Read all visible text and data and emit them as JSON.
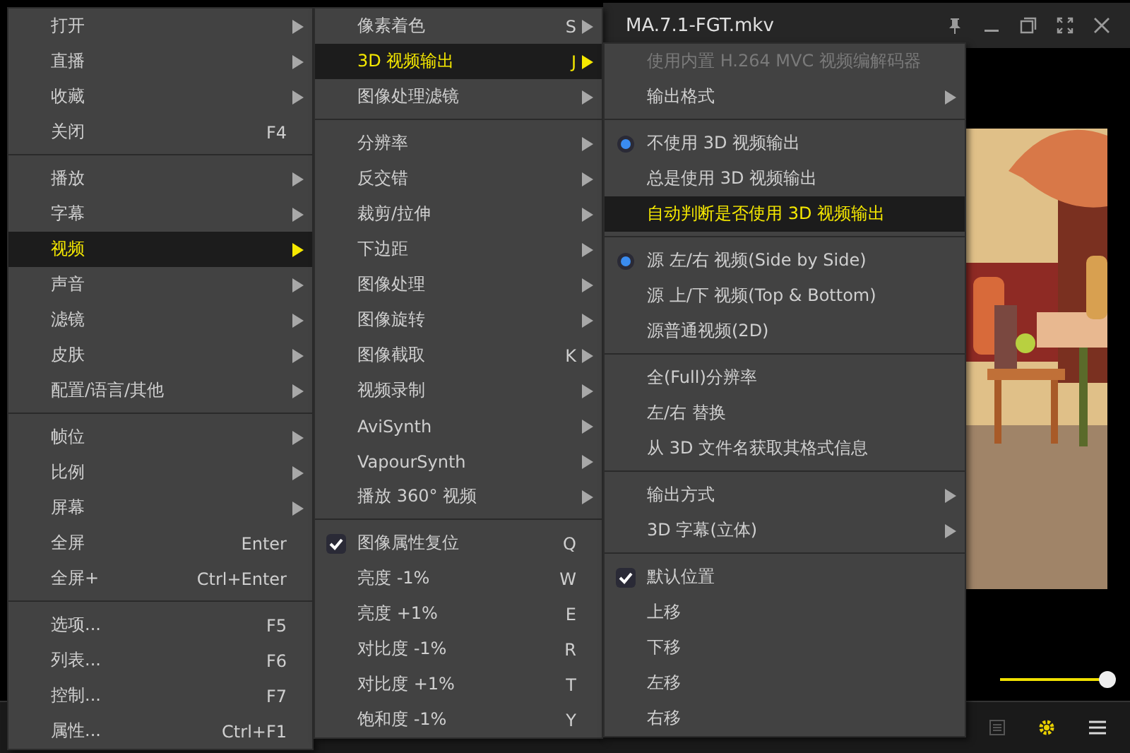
{
  "window": {
    "title": "MA.7.1-FGT.mkv"
  },
  "volume": {
    "level": 0.95
  },
  "menus": [
    {
      "items": [
        {
          "kind": "item",
          "label": "打开",
          "submenu": true,
          "selected": false
        },
        {
          "kind": "item",
          "label": "直播",
          "submenu": true,
          "selected": false
        },
        {
          "kind": "item",
          "label": "收藏",
          "submenu": true,
          "selected": false
        },
        {
          "kind": "item",
          "label": "关闭",
          "shortcut": "F4",
          "selected": false
        },
        {
          "kind": "separator"
        },
        {
          "kind": "item",
          "label": "播放",
          "submenu": true,
          "selected": false
        },
        {
          "kind": "item",
          "label": "字幕",
          "submenu": true,
          "selected": false
        },
        {
          "kind": "item",
          "label": "视频",
          "submenu": true,
          "selected": true
        },
        {
          "kind": "item",
          "label": "声音",
          "submenu": true,
          "selected": false
        },
        {
          "kind": "item",
          "label": "滤镜",
          "submenu": true,
          "selected": false
        },
        {
          "kind": "item",
          "label": "皮肤",
          "submenu": true,
          "selected": false
        },
        {
          "kind": "item",
          "label": "配置/语言/其他",
          "submenu": true,
          "selected": false
        },
        {
          "kind": "separator"
        },
        {
          "kind": "item",
          "label": "帧位",
          "submenu": true,
          "selected": false
        },
        {
          "kind": "item",
          "label": "比例",
          "submenu": true,
          "selected": false
        },
        {
          "kind": "item",
          "label": "屏幕",
          "submenu": true,
          "selected": false
        },
        {
          "kind": "item",
          "label": "全屏",
          "shortcut": "Enter",
          "selected": false
        },
        {
          "kind": "item",
          "label": "全屏+",
          "shortcut": "Ctrl+Enter",
          "selected": false
        },
        {
          "kind": "separator"
        },
        {
          "kind": "item",
          "label": "选项...",
          "shortcut": "F5",
          "selected": false
        },
        {
          "kind": "item",
          "label": "列表...",
          "shortcut": "F6",
          "selected": false
        },
        {
          "kind": "item",
          "label": "控制...",
          "shortcut": "F7",
          "selected": false
        },
        {
          "kind": "item",
          "label": "属性...",
          "shortcut": "Ctrl+F1",
          "selected": false
        }
      ]
    },
    {
      "items": [
        {
          "kind": "item",
          "label": "像素着色",
          "shortcut": "S",
          "submenu": true,
          "selected": false
        },
        {
          "kind": "item",
          "label": "3D 视频输出",
          "shortcut": "J",
          "submenu": true,
          "selected": true
        },
        {
          "kind": "item",
          "label": "图像处理滤镜",
          "submenu": true,
          "selected": false
        },
        {
          "kind": "separator"
        },
        {
          "kind": "item",
          "label": "分辨率",
          "submenu": true,
          "selected": false
        },
        {
          "kind": "item",
          "label": "反交错",
          "submenu": true,
          "selected": false
        },
        {
          "kind": "item",
          "label": "裁剪/拉伸",
          "submenu": true,
          "selected": false
        },
        {
          "kind": "item",
          "label": "下边距",
          "submenu": true,
          "selected": false
        },
        {
          "kind": "item",
          "label": "图像处理",
          "submenu": true,
          "selected": false
        },
        {
          "kind": "item",
          "label": "图像旋转",
          "submenu": true,
          "selected": false
        },
        {
          "kind": "item",
          "label": "图像截取",
          "shortcut": "K",
          "submenu": true,
          "selected": false
        },
        {
          "kind": "item",
          "label": "视频录制",
          "submenu": true,
          "selected": false
        },
        {
          "kind": "item",
          "label": "AviSynth",
          "submenu": true,
          "selected": false
        },
        {
          "kind": "item",
          "label": "VapourSynth",
          "submenu": true,
          "selected": false
        },
        {
          "kind": "item",
          "label": "播放 360° 视频",
          "submenu": true,
          "selected": false
        },
        {
          "kind": "separator"
        },
        {
          "kind": "check",
          "label": "图像属性复位",
          "shortcut": "Q",
          "checked": true,
          "selected": false
        },
        {
          "kind": "item",
          "label": "亮度 -1%",
          "shortcut": "W",
          "selected": false
        },
        {
          "kind": "item",
          "label": "亮度 +1%",
          "shortcut": "E",
          "selected": false
        },
        {
          "kind": "item",
          "label": "对比度 -1%",
          "shortcut": "R",
          "selected": false
        },
        {
          "kind": "item",
          "label": "对比度 +1%",
          "shortcut": "T",
          "selected": false
        },
        {
          "kind": "item",
          "label": "饱和度 -1%",
          "shortcut": "Y",
          "selected": false
        }
      ]
    },
    {
      "items": [
        {
          "kind": "item",
          "label": "使用内置 H.264 MVC 视频编解码器",
          "disabled": true,
          "selected": false
        },
        {
          "kind": "item",
          "label": "输出格式",
          "submenu": true,
          "selected": false
        },
        {
          "kind": "separator"
        },
        {
          "kind": "radio",
          "label": "不使用 3D 视频输出",
          "checked": true,
          "selected": false
        },
        {
          "kind": "radio",
          "label": "总是使用 3D 视频输出",
          "checked": false,
          "selected": false
        },
        {
          "kind": "radio",
          "label": "自动判断是否使用 3D 视频输出",
          "checked": false,
          "selected": true
        },
        {
          "kind": "separator"
        },
        {
          "kind": "radio",
          "label": "源 左/右 视频(Side by Side)",
          "checked": true,
          "selected": false
        },
        {
          "kind": "radio",
          "label": "源 上/下 视频(Top & Bottom)",
          "checked": false,
          "selected": false
        },
        {
          "kind": "radio",
          "label": "源普通视频(2D)",
          "checked": false,
          "selected": false
        },
        {
          "kind": "separator"
        },
        {
          "kind": "item",
          "label": "全(Full)分辨率",
          "selected": false
        },
        {
          "kind": "item",
          "label": "左/右 替换",
          "selected": false
        },
        {
          "kind": "item",
          "label": "从 3D 文件名获取其格式信息",
          "selected": false
        },
        {
          "kind": "separator"
        },
        {
          "kind": "item",
          "label": "输出方式",
          "submenu": true,
          "selected": false
        },
        {
          "kind": "item",
          "label": "3D 字幕(立体)",
          "submenu": true,
          "selected": false
        },
        {
          "kind": "separator"
        },
        {
          "kind": "check",
          "label": "默认位置",
          "checked": true,
          "selected": false
        },
        {
          "kind": "item",
          "label": "上移",
          "selected": false
        },
        {
          "kind": "item",
          "label": "下移",
          "selected": false
        },
        {
          "kind": "item",
          "label": "左移",
          "selected": false
        },
        {
          "kind": "item",
          "label": "右移",
          "selected": false
        }
      ]
    }
  ]
}
